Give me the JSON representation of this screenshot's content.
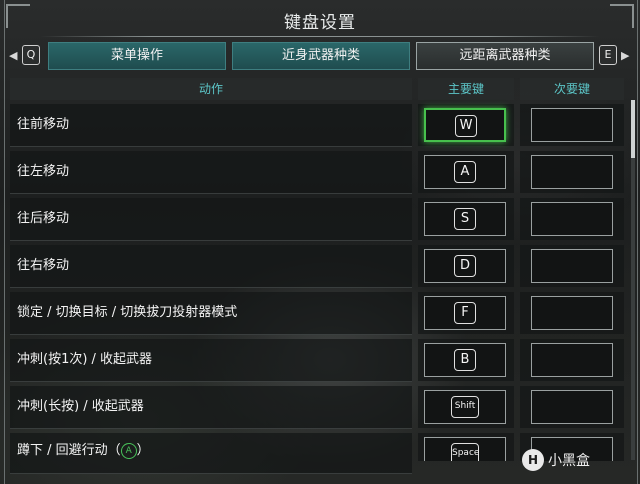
{
  "title": "键盘设置",
  "tabs": {
    "prev_key": "Q",
    "next_key": "E",
    "prev_arrow": "◀",
    "next_arrow": "▶",
    "items": [
      {
        "label": "菜单操作"
      },
      {
        "label": "近身武器种类"
      },
      {
        "label": "远距离武器种类"
      }
    ]
  },
  "columns": {
    "action": "动作",
    "primary": "主要键",
    "secondary": "次要键"
  },
  "rows": [
    {
      "label": "往前移动",
      "primary": "W"
    },
    {
      "label": "往左移动",
      "primary": "A"
    },
    {
      "label": "往后移动",
      "primary": "S"
    },
    {
      "label": "往右移动",
      "primary": "D"
    },
    {
      "label": "锁定 / 切换目标 / 切换拔刀投射器模式",
      "primary": "F"
    },
    {
      "label": "冲刺(按1次) / 收起武器",
      "primary": "B"
    },
    {
      "label": "冲刺(长按) / 收起武器",
      "primary": "Shift"
    },
    {
      "label": "蹲下 / 回避行动（",
      "label_tail": "）",
      "button_glyph": "A",
      "primary": "Space"
    }
  ],
  "watermark": {
    "text": "小黑盒",
    "logo": "H"
  },
  "colors": {
    "accent": "#5cc6c8",
    "tab": "#2a6769",
    "selection": "#47c04d"
  }
}
